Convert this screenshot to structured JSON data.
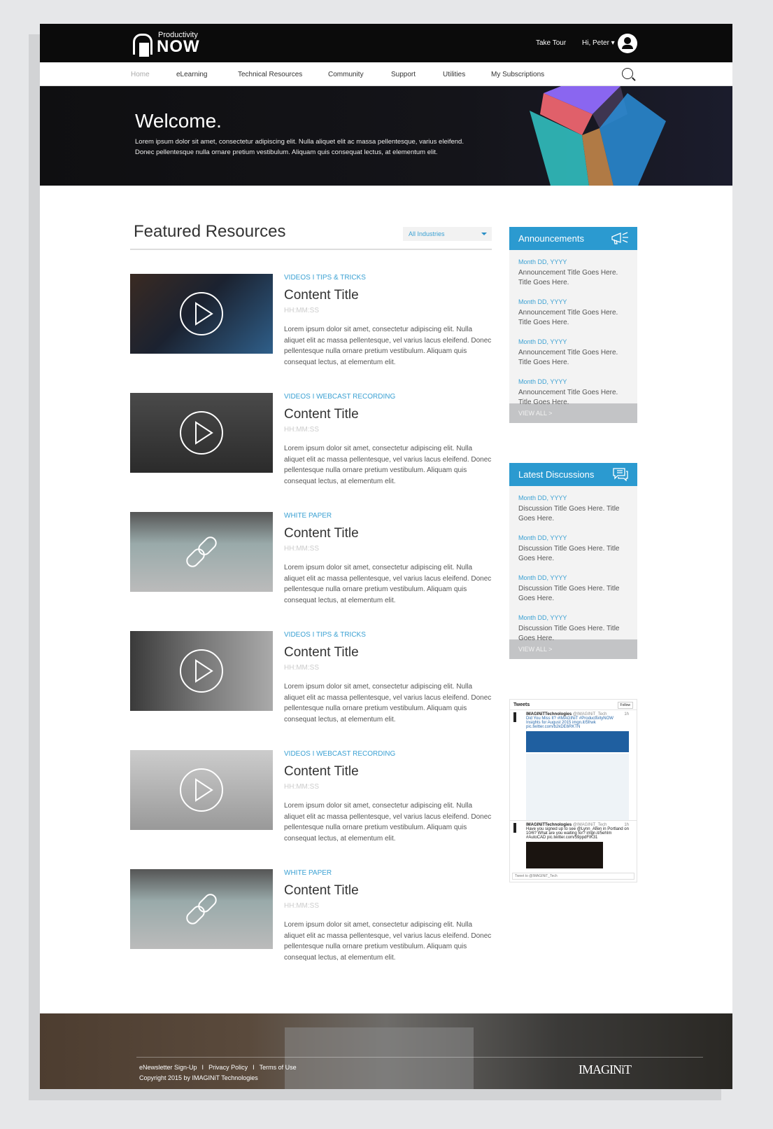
{
  "header": {
    "logo_top": "Productivity",
    "logo_main": "NOW",
    "take_tour": "Take Tour",
    "user_greeting": "Hi, Peter ▾"
  },
  "nav": {
    "items": [
      "Home",
      "eLearning",
      "Technical Resources",
      "Community",
      "Support",
      "Utilities",
      "My Subscriptions"
    ]
  },
  "hero": {
    "title": "Welcome.",
    "text": "Lorem ipsum dolor sit amet, consectetur adipiscing elit. Nulla aliquet elit ac massa pellentesque, varius eleifend. Donec pellentesque nulla ornare pretium vestibulum. Aliquam quis consequat lectus, at elementum elit."
  },
  "featured": {
    "title": "Featured Resources",
    "filter": "All Industries",
    "items": [
      {
        "category": "VIDEOS  I  TIPS & TRICKS",
        "title": "Content Title",
        "duration": "HH:MM:SS",
        "desc": "Lorem ipsum dolor sit amet, consectetur adipiscing elit. Nulla aliquet elit ac massa pellentesque, vel varius lacus eleifend. Donec pellentesque nulla ornare pretium vestibulum. Aliquam quis consequat lectus, at elementum elit."
      },
      {
        "category": "VIDEOS  I  WEBCAST RECORDING",
        "title": "Content Title",
        "duration": "HH:MM:SS",
        "desc": "Lorem ipsum dolor sit amet, consectetur adipiscing elit. Nulla aliquet elit ac massa pellentesque, vel varius lacus eleifend. Donec pellentesque nulla ornare pretium vestibulum. Aliquam quis consequat lectus, at elementum elit."
      },
      {
        "category": "WHITE PAPER",
        "title": "Content Title",
        "duration": "HH:MM:SS",
        "desc": "Lorem ipsum dolor sit amet, consectetur adipiscing elit. Nulla aliquet elit ac massa pellentesque, vel varius lacus eleifend. Donec pellentesque nulla ornare pretium vestibulum. Aliquam quis consequat lectus, at elementum elit."
      },
      {
        "category": "VIDEOS  I  TIPS & TRICKS",
        "title": "Content Title",
        "duration": "HH:MM:SS",
        "desc": "Lorem ipsum dolor sit amet, consectetur adipiscing elit. Nulla aliquet elit ac massa pellentesque, vel varius lacus eleifend. Donec pellentesque nulla ornare pretium vestibulum. Aliquam quis consequat lectus, at elementum elit."
      },
      {
        "category": "VIDEOS  I  WEBCAST RECORDING",
        "title": "Content Title",
        "duration": "HH:MM:SS",
        "desc": "Lorem ipsum dolor sit amet, consectetur adipiscing elit. Nulla aliquet elit ac massa pellentesque, vel varius lacus eleifend. Donec pellentesque nulla ornare pretium vestibulum. Aliquam quis consequat lectus, at elementum elit."
      },
      {
        "category": "WHITE PAPER",
        "title": "Content Title",
        "duration": "HH:MM:SS",
        "desc": "Lorem ipsum dolor sit amet, consectetur adipiscing elit. Nulla aliquet elit ac massa pellentesque, vel varius lacus eleifend. Donec pellentesque nulla ornare pretium vestibulum. Aliquam quis consequat lectus, at elementum elit."
      }
    ]
  },
  "announcements": {
    "title": "Announcements",
    "view_all": "VIEW ALL  >",
    "items": [
      {
        "date": "Month DD, YYYY",
        "text": "Announcement Title Goes Here. Title Goes Here."
      },
      {
        "date": "Month DD, YYYY",
        "text": "Announcement Title Goes Here. Title Goes Here."
      },
      {
        "date": "Month DD, YYYY",
        "text": "Announcement Title Goes Here. Title Goes Here."
      },
      {
        "date": "Month DD, YYYY",
        "text": "Announcement Title Goes Here. Title Goes Here."
      }
    ]
  },
  "discussions": {
    "title": "Latest Discussions",
    "view_all": "VIEW ALL  >",
    "items": [
      {
        "date": "Month DD, YYYY",
        "text": "Discussion Title Goes Here. Title Goes Here."
      },
      {
        "date": "Month DD, YYYY",
        "text": "Discussion Title Goes Here. Title Goes Here."
      },
      {
        "date": "Month DD, YYYY",
        "text": "Discussion Title Goes Here. Title Goes Here."
      },
      {
        "date": "Month DD, YYYY",
        "text": "Discussion Title Goes Here. Title Goes Here."
      }
    ]
  },
  "tweets": {
    "title": "Tweets",
    "follow": "Follow",
    "items": [
      {
        "user": "IMAGINiTTechnologies",
        "handle": "@IMAGINiT_Tech",
        "time": "1h",
        "text": "Did You Miss It? #IMAGINiT #ProductivityNOW Insights for August 2015 imgn.it/5frwk pic.twitter.com/b2kDE6RKTN"
      },
      {
        "user": "IMAGINiTTechnologies",
        "handle": "@IMAGINiT_Tech",
        "time": "1h",
        "text": "Have you signed up to see @Lynn_Allen in Portland on 10/6? What are you waiting for? imgn.it/5ehIm #AutoCAD pic.twitter.com/59ppdFIK31"
      }
    ],
    "compose_placeholder": "Tweet to @IMAGINiT_Tech"
  },
  "footer": {
    "links": [
      "eNewsletter Sign-Up",
      "I",
      "Privacy Policy",
      "I",
      "Terms of Use"
    ],
    "copyright": "Copyright 2015 by IMAGINiT Technologies",
    "logo": "IMAGINiT"
  },
  "colors": {
    "accent": "#2b9ad0",
    "header": "#0b0b0b",
    "panel": "#f3f3f3",
    "view_all": "#c3c4c6"
  }
}
